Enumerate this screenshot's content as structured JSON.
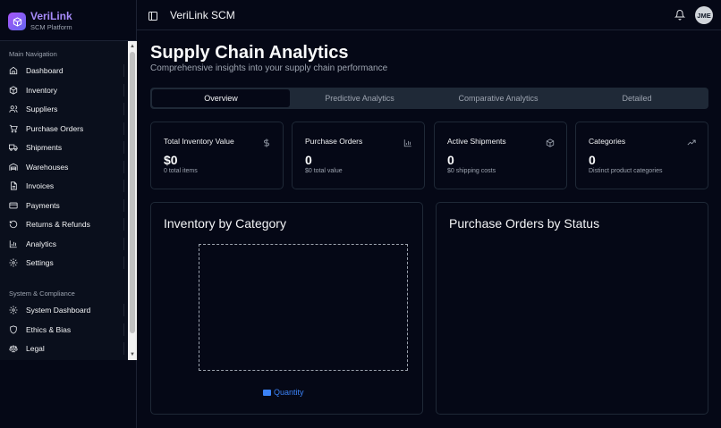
{
  "brand": {
    "title": "VeriLink",
    "subtitle": "SCM Platform"
  },
  "sidebar": {
    "main_section": "Main Navigation",
    "main_items": [
      {
        "label": "Dashboard",
        "icon": "home-icon"
      },
      {
        "label": "Inventory",
        "icon": "box-icon"
      },
      {
        "label": "Suppliers",
        "icon": "users-icon"
      },
      {
        "label": "Purchase Orders",
        "icon": "cart-icon"
      },
      {
        "label": "Shipments",
        "icon": "truck-icon"
      },
      {
        "label": "Warehouses",
        "icon": "warehouse-icon"
      },
      {
        "label": "Invoices",
        "icon": "file-icon"
      },
      {
        "label": "Payments",
        "icon": "credit-card-icon"
      },
      {
        "label": "Returns & Refunds",
        "icon": "rotate-icon"
      },
      {
        "label": "Analytics",
        "icon": "bar-chart-icon"
      },
      {
        "label": "Settings",
        "icon": "gear-icon"
      }
    ],
    "system_section": "System & Compliance",
    "system_items": [
      {
        "label": "System Dashboard",
        "icon": "gear-icon"
      },
      {
        "label": "Ethics & Bias",
        "icon": "shield-icon"
      },
      {
        "label": "Legal",
        "icon": "scale-icon"
      }
    ]
  },
  "header": {
    "title": "VeriLink SCM",
    "avatar": "JME"
  },
  "page": {
    "title": "Supply Chain Analytics",
    "subtitle": "Comprehensive insights into your supply chain performance"
  },
  "tabs": [
    "Overview",
    "Predictive Analytics",
    "Comparative Analytics",
    "Detailed"
  ],
  "stats": [
    {
      "label": "Total Inventory Value",
      "value": "$0",
      "sub": "0 total items",
      "icon": "dollar-icon"
    },
    {
      "label": "Purchase Orders",
      "value": "0",
      "sub": "$0 total value",
      "icon": "bar-chart-icon"
    },
    {
      "label": "Active Shipments",
      "value": "0",
      "sub": "$0 shipping costs",
      "icon": "package-icon"
    },
    {
      "label": "Categories",
      "value": "0",
      "sub": "Distinct product categories",
      "icon": "trending-up-icon"
    }
  ],
  "panels": {
    "inventory": {
      "title": "Inventory by Category",
      "legend": "Quantity"
    },
    "orders": {
      "title": "Purchase Orders by Status"
    }
  },
  "colors": {
    "accent": "#a78bfa",
    "legend": "#3b82f6",
    "background": "#050816"
  }
}
